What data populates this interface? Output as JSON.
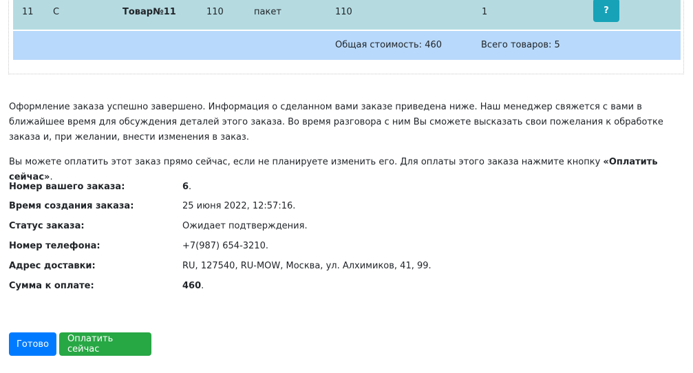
{
  "table": {
    "row": {
      "num": "11",
      "code": "С",
      "name": "Товар№11",
      "price": "110",
      "unit": "пакет",
      "sum": "110",
      "qty": "1",
      "help_label": "?"
    },
    "totals": {
      "total_cost": "Общая стоимость: 460",
      "total_items": "Всего товаров: 5"
    }
  },
  "message": {
    "p1": "Оформление заказа успешно завершено. Информация о сделанном вами заказе приведена ниже. Наш менеджер свяжется с вами в ближайшее время для обсуждения деталей этого заказа. Во время разговора с ним Вы сможете высказать свои пожелания к обработке заказа и, при желании, внести изменения в заказ.",
    "p2_prefix": "Вы можете оплатить этот заказ прямо сейчас, если не планируете изменить его. Для оплаты этого заказа нажмите кнопку ",
    "p2_bold": "«Оплатить сейчас»",
    "p2_suffix": "."
  },
  "order_info": {
    "number_label": "Номер вашего заказа:",
    "number_value": "6",
    "created_label": "Время создания заказа:",
    "created_value": "25 июня 2022, 12:57:16.",
    "status_label": "Статус заказа:",
    "status_value": "Ожидает подтверждения.",
    "phone_label": "Номер телефона:",
    "phone_value": "+7(987) 654-3210.",
    "address_label": "Адрес доставки:",
    "address_value": "RU, 127540, RU-MOW, Москва, ул. Алхимиков, 41, 99.",
    "sum_label": "Сумма к оплате:",
    "sum_value": "460",
    "period": "."
  },
  "buttons": {
    "done": "Готово",
    "pay_now": "Оплатить сейчас"
  },
  "colors": {
    "row_bg": "#b5dbe1",
    "total_bg": "#b8d9fb",
    "info_btn": "#17a2b8",
    "primary": "#007bff",
    "success": "#28a745"
  }
}
